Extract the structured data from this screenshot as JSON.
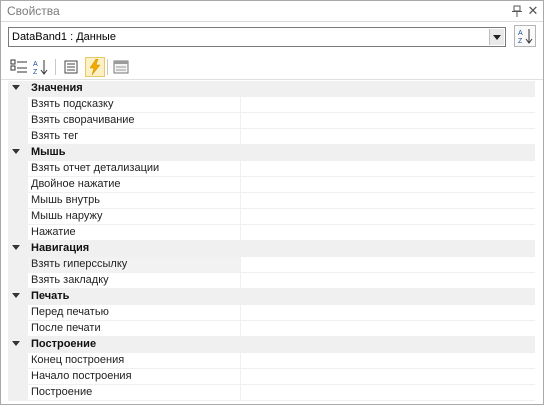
{
  "window": {
    "title": "Свойства"
  },
  "object_selector": {
    "value": "DataBand1 : Данные"
  },
  "categories": [
    {
      "name": "Значения",
      "properties": [
        "Взять подсказку",
        "Взять сворачивание",
        "Взять тег"
      ]
    },
    {
      "name": "Мышь",
      "properties": [
        "Взять отчет детализации",
        "Двойное нажатие",
        "Мышь внутрь",
        "Мышь наружу",
        "Нажатие"
      ]
    },
    {
      "name": "Навигация",
      "properties": [
        "Взять гиперссылку",
        "Взять закладку"
      ]
    },
    {
      "name": "Печать",
      "properties": [
        "Перед печатью",
        "После печати"
      ]
    },
    {
      "name": "Построение",
      "properties": [
        "Конец построения",
        "Начало построения",
        "Построение"
      ]
    }
  ],
  "selected_property": "Взять гиперссылку",
  "colors": {
    "accent_active_tab": "#fdf1c4",
    "category_bg": "#f0f0f0"
  }
}
